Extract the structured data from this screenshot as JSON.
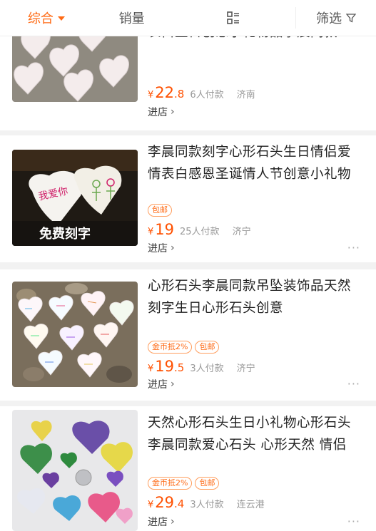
{
  "sort_bar": {
    "tab_default": "综合",
    "tab_sales": "销量",
    "tab_view": "list-view-icon",
    "tab_filter": "筛选"
  },
  "items": [
    {
      "title": "表白生日创意小礼物品李晨同款",
      "tags": [],
      "price_int": "22",
      "price_dec": ".8",
      "sold": "6人付款",
      "location": "济南",
      "shop": "进店"
    },
    {
      "title": "李晨同款刻字心形石头生日情侣爱情表白感恩圣诞情人节创意小礼物",
      "tags": [
        "包邮"
      ],
      "price_int": "19",
      "price_dec": "",
      "sold": "25人付款",
      "location": "济宁",
      "shop": "进店",
      "image_text_1": "我爱你",
      "image_text_2": "免费刻字"
    },
    {
      "title": "心形石头李晨同款吊坠装饰品天然刻字生日心形石头创意",
      "tags": [
        "金币抵2%",
        "包邮"
      ],
      "price_int": "19",
      "price_dec": ".5",
      "sold": "3人付款",
      "location": "济宁",
      "shop": "进店"
    },
    {
      "title": "天然心形石头生日小礼物心形石头李晨同款爱心石头 心形天然 情侣",
      "tags": [
        "金币抵2%",
        "包邮"
      ],
      "price_int": "29",
      "price_dec": ".4",
      "sold": "3人付款",
      "location": "连云港",
      "shop": "进店"
    }
  ],
  "colors": {
    "accent": "#ff6a14",
    "price": "#ff5000"
  }
}
